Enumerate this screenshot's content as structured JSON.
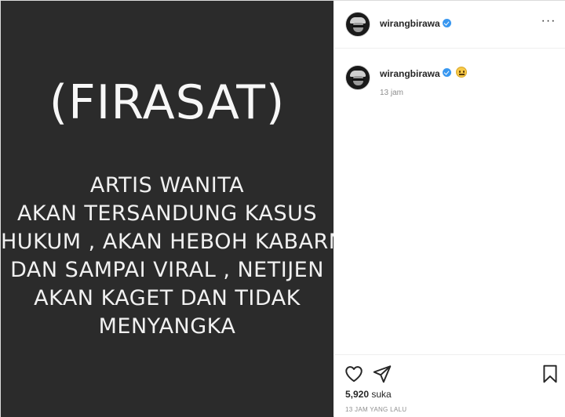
{
  "post_image": {
    "title": "(FIRASAT)",
    "lines": [
      "ARTIS WANITA",
      "AKAN TERSANDUNG KASUS",
      "HUKUM , AKAN HEBOH KABARNYA",
      "DAN SAMPAI VIRAL , NETIJEN",
      "AKAN KAGET DAN TIDAK",
      "MENYANGKA"
    ],
    "background": "#2b2b2b"
  },
  "header": {
    "username": "wirangbirawa",
    "verified_icon": "verified-badge-icon",
    "more_icon": "more-options-icon",
    "more_symbol": "···"
  },
  "caption": {
    "username": "wirangbirawa",
    "emoji": "neutral-face-emoji",
    "time": "13 jam"
  },
  "actions": {
    "like_icon": "heart-icon",
    "share_icon": "paper-plane-icon",
    "save_icon": "bookmark-icon",
    "likes_count": "5,920",
    "likes_word": "suka",
    "posted_time": "13 JAM YANG LALU"
  },
  "colors": {
    "verified": "#3897f0",
    "muted_text": "#8e8e8e",
    "text": "#262626"
  }
}
